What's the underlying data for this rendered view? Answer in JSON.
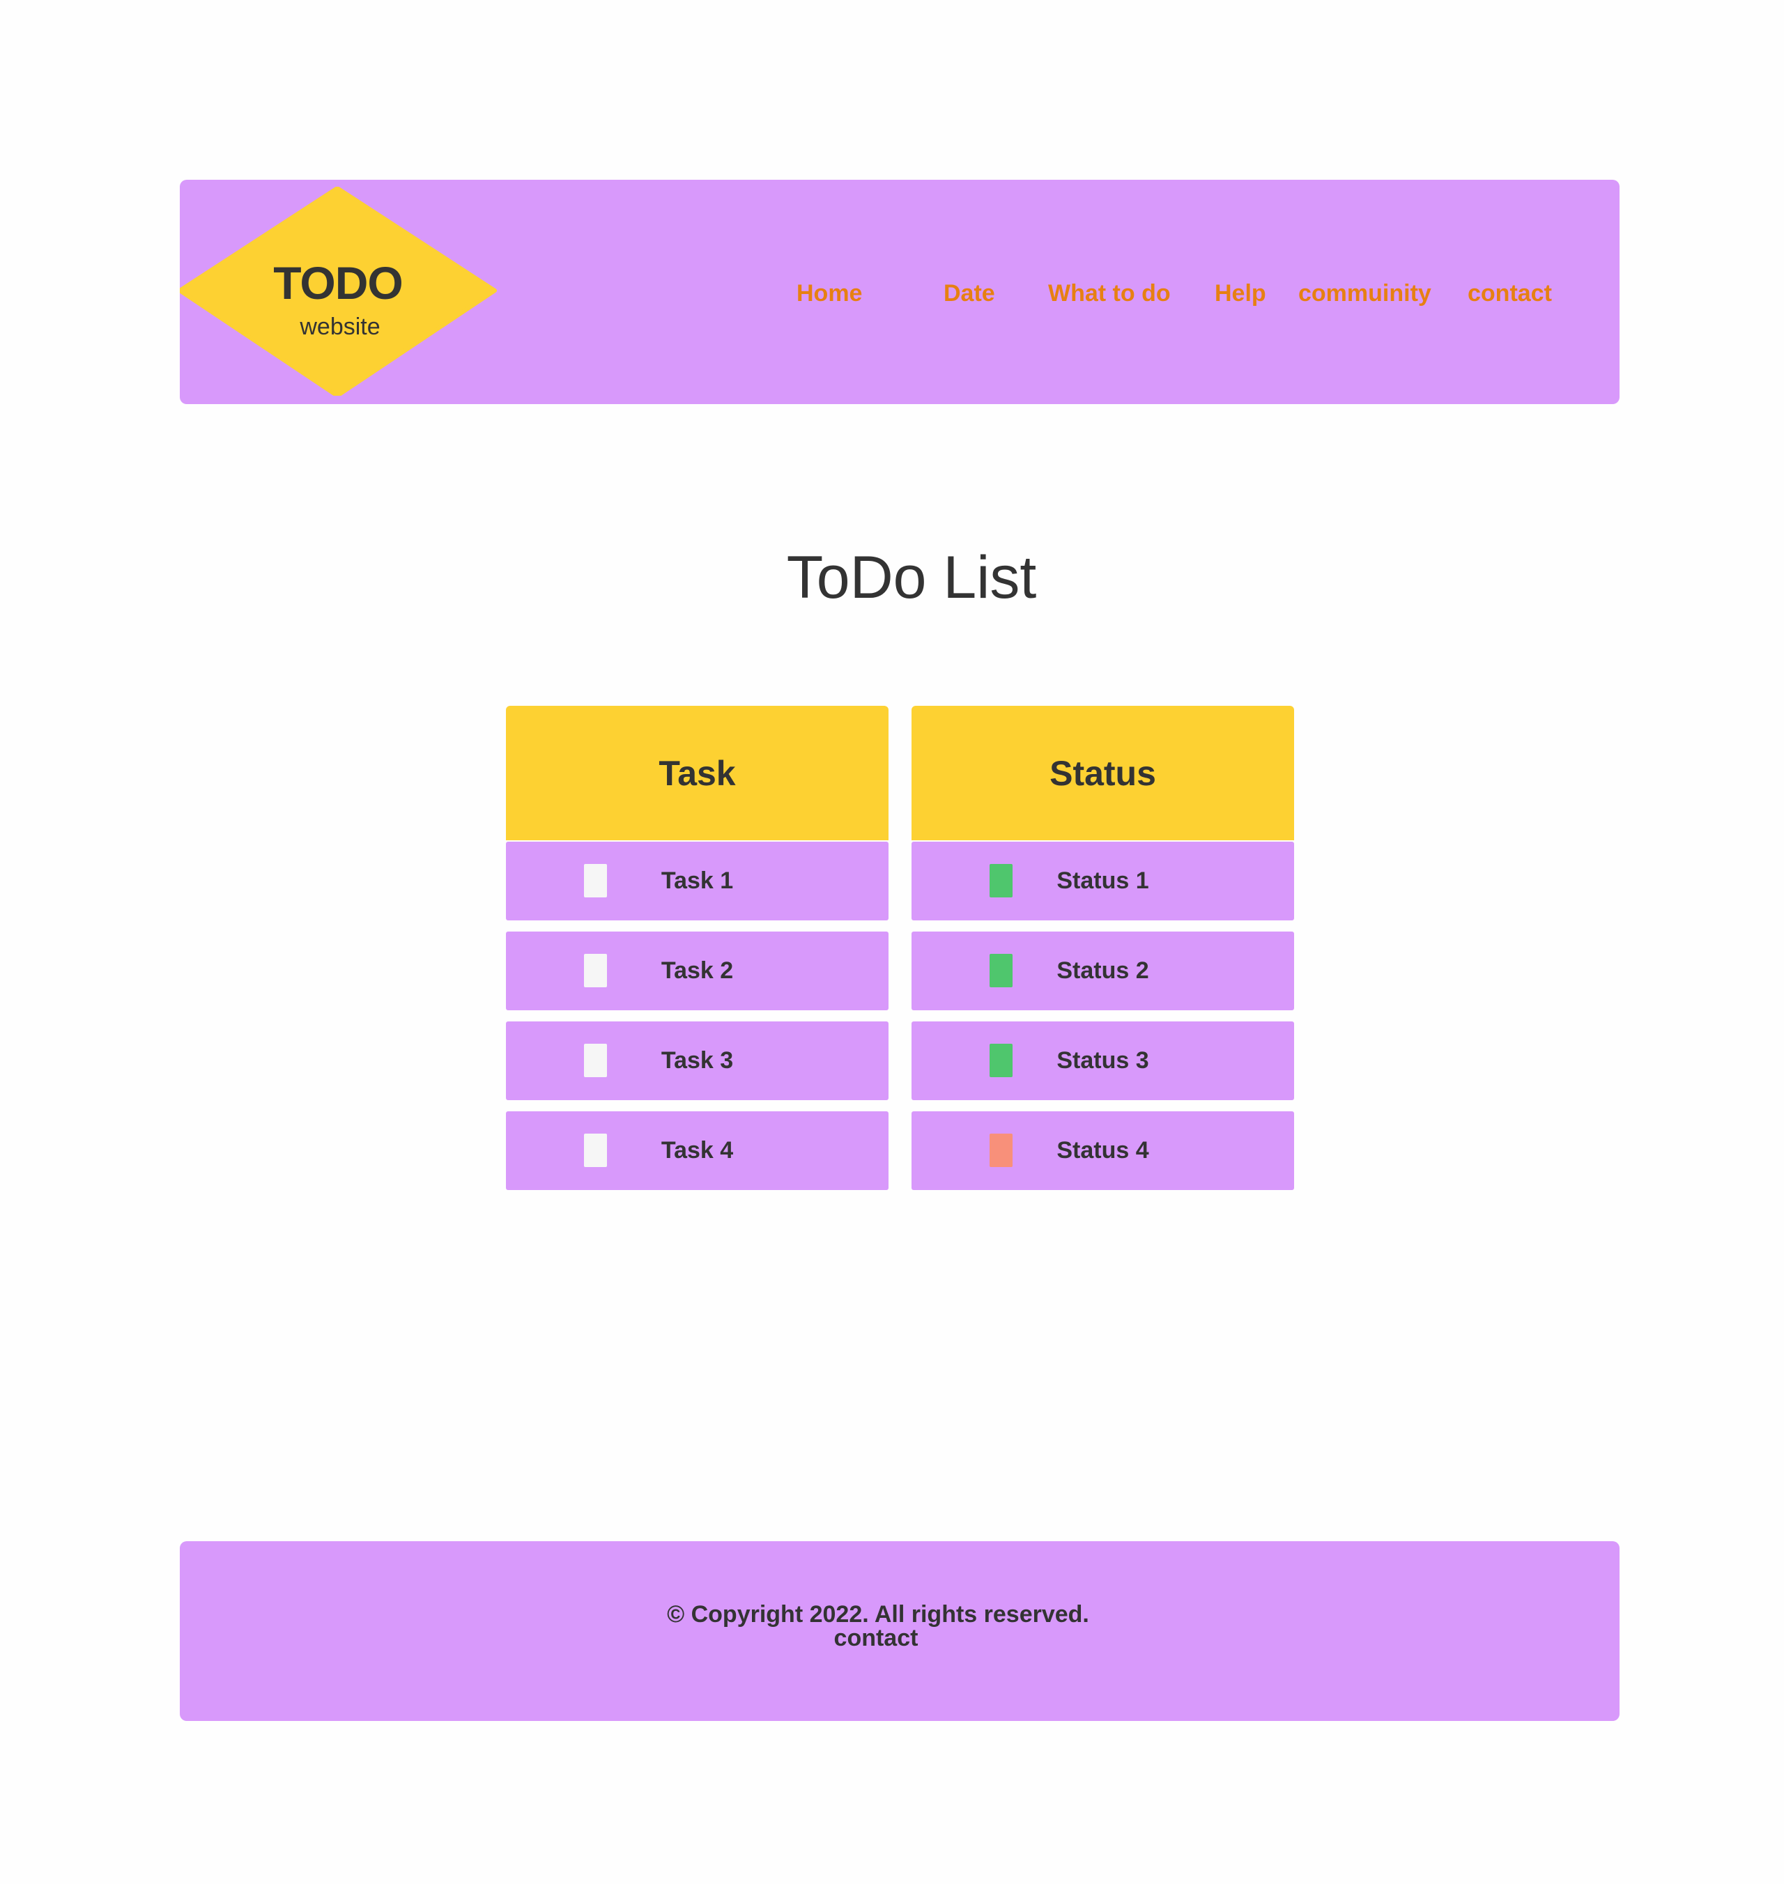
{
  "header": {
    "logo": {
      "title": "TODO",
      "subtitle": "website"
    },
    "nav": [
      "Home",
      "Date",
      "What to do",
      "Help",
      "commuinity",
      "contact"
    ]
  },
  "page_title": "ToDo List",
  "table": {
    "task_header": "Task",
    "status_header": "Status",
    "tasks": [
      "Task 1",
      "Task 2",
      "Task 3",
      "Task 4"
    ],
    "statuses": [
      "Status 1",
      "Status 2",
      "Status 3",
      "Status 4"
    ],
    "status_colors": [
      "#4fc66d",
      "#4fc66d",
      "#4fc66d",
      "#f8907a"
    ]
  },
  "footer": {
    "copyright": "© Copyright 2022. All rights reserved.",
    "contact": "contact"
  },
  "colors": {
    "primary": "#d899fb",
    "accent": "#fdd132",
    "nav_text": "#e78012",
    "text": "#333333"
  }
}
